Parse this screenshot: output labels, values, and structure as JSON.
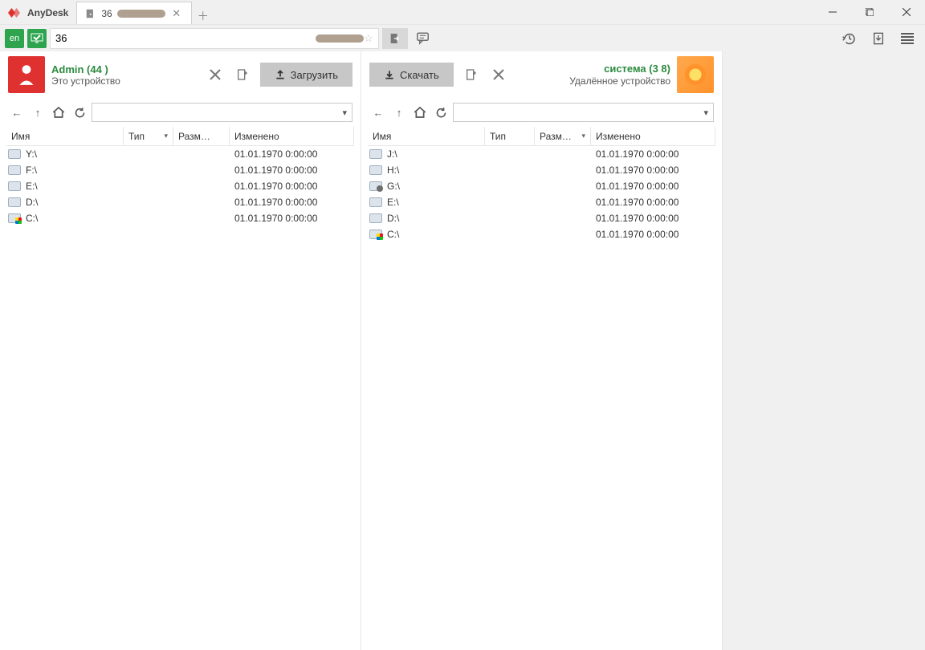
{
  "app_name": "AnyDesk",
  "tab_title": "36",
  "address_value": "36",
  "local": {
    "title": "Admin (44          )",
    "subtitle": "Это устройство",
    "transfer_label": "Загрузить",
    "columns": {
      "name": "Имя",
      "type": "Тип",
      "size": "Разм…",
      "mod": "Изменено"
    },
    "drives": [
      {
        "name": "Y:\\",
        "icon": "drive",
        "mod": "01.01.1970 0:00:00"
      },
      {
        "name": "F:\\",
        "icon": "drive",
        "mod": "01.01.1970 0:00:00"
      },
      {
        "name": "E:\\",
        "icon": "drive",
        "mod": "01.01.1970 0:00:00"
      },
      {
        "name": "D:\\",
        "icon": "drive",
        "mod": "01.01.1970 0:00:00"
      },
      {
        "name": "C:\\",
        "icon": "win",
        "mod": "01.01.1970 0:00:00"
      }
    ]
  },
  "remote": {
    "title": "система (3          8)",
    "subtitle": "Удалённое устройство",
    "transfer_label": "Скачать",
    "columns": {
      "name": "Имя",
      "type": "Тип",
      "size": "Разм…",
      "mod": "Изменено"
    },
    "drives": [
      {
        "name": "J:\\",
        "icon": "drive",
        "mod": "01.01.1970 0:00:00"
      },
      {
        "name": "H:\\",
        "icon": "drive",
        "mod": "01.01.1970 0:00:00"
      },
      {
        "name": "G:\\",
        "icon": "usb",
        "mod": "01.01.1970 0:00:00"
      },
      {
        "name": "E:\\",
        "icon": "drive",
        "mod": "01.01.1970 0:00:00"
      },
      {
        "name": "D:\\",
        "icon": "drive",
        "mod": "01.01.1970 0:00:00"
      },
      {
        "name": "C:\\",
        "icon": "win",
        "mod": "01.01.1970 0:00:00"
      }
    ]
  }
}
